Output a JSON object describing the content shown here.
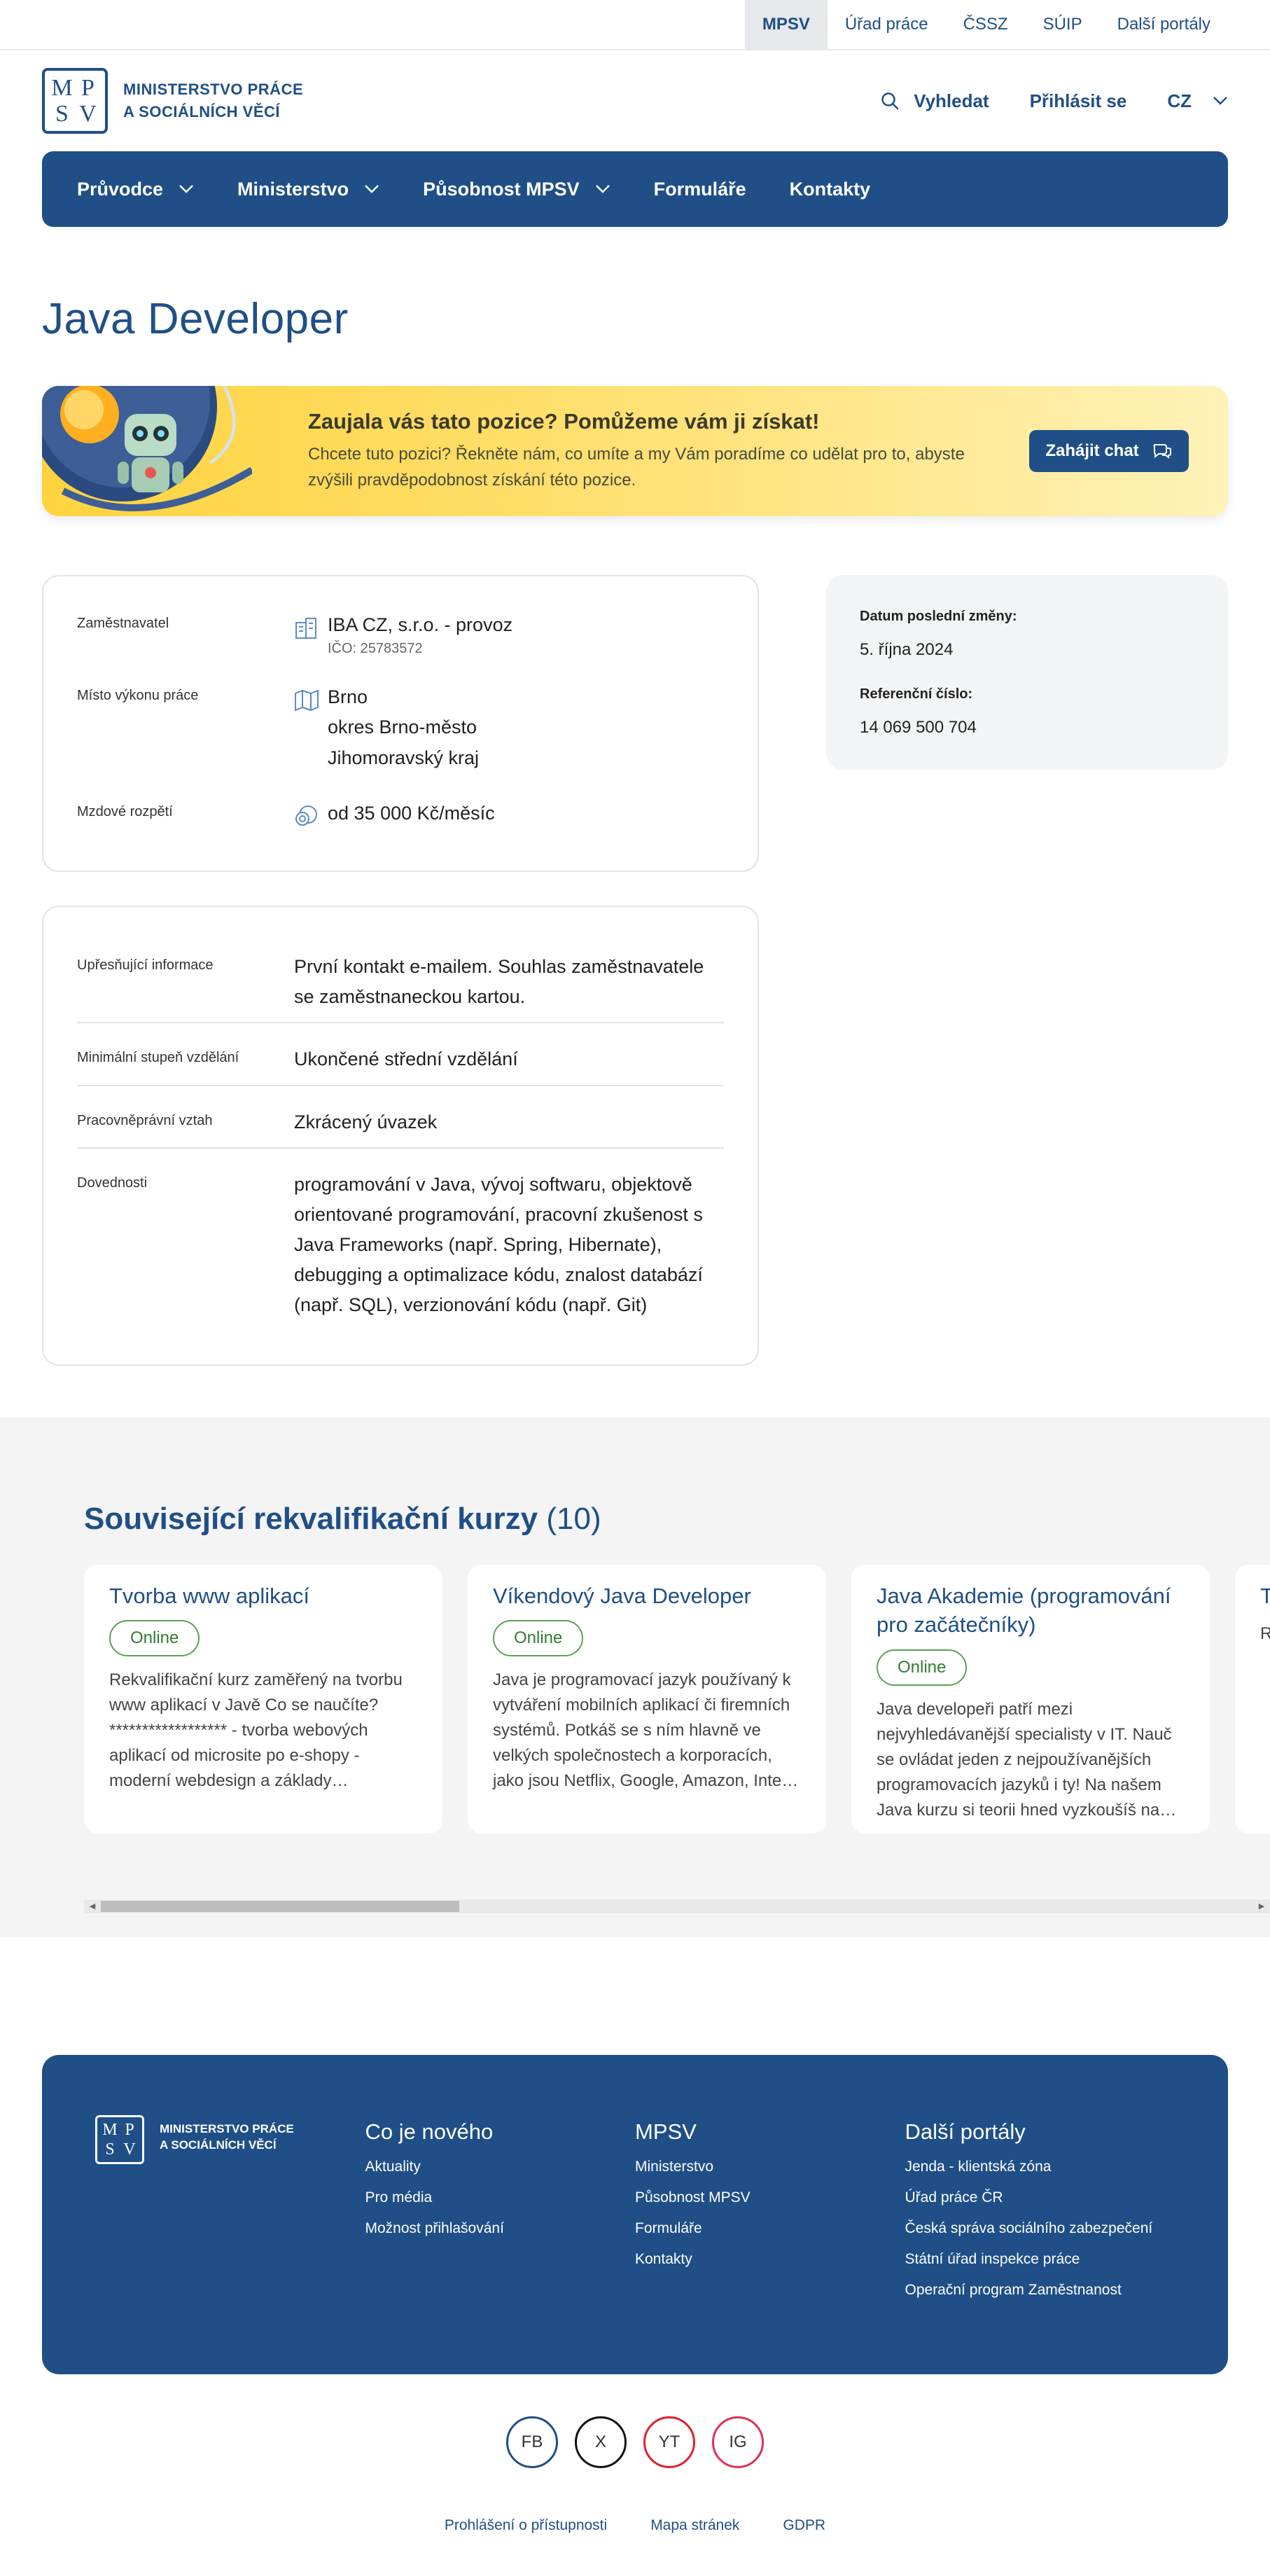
{
  "topbar": {
    "links": [
      "MPSV",
      "Úřad práce",
      "ČSSZ",
      "SÚIP",
      "Další portály"
    ],
    "active": "MPSV"
  },
  "logo": {
    "letters": [
      "M",
      "P",
      "S",
      "V"
    ],
    "line1": "MINISTERSTVO PRÁCE",
    "line2": "A SOCIÁLNÍCH VĚCÍ"
  },
  "header": {
    "search_label": "Vyhledat",
    "login_label": "Přihlásit se",
    "lang_label": "CZ"
  },
  "nav": {
    "items": [
      "Průvodce",
      "Ministerstvo",
      "Působnost MPSV",
      "Formuláře",
      "Kontakty"
    ]
  },
  "page_title": "Java Developer",
  "banner": {
    "title": "Zaujala vás tato pozice? Pomůžeme vám ji získat!",
    "subtitle": "Chcete tuto pozici? Řekněte nám, co umíte a my Vám poradíme co udělat pro to, abyste zvýšili pravděpodobnost získání této pozice.",
    "button": "Zahájit chat"
  },
  "job": {
    "employer_label": "Zaměstnavatel",
    "employer_name": "IBA CZ, s.r.o. - provoz",
    "employer_ico": "IČO: 25783572",
    "location_label": "Místo výkonu práce",
    "location_city": "Brno",
    "location_district": "okres Brno-město",
    "location_region": "Jihomoravský kraj",
    "salary_label": "Mzdové rozpětí",
    "salary_value": "od 35 000 Kč/měsíc"
  },
  "details": [
    {
      "label": "Upřesňující informace",
      "value": "První kontakt e-mailem. Souhlas zaměstnavatele se zaměstnaneckou kartou."
    },
    {
      "label": "Minimální stupeň vzdělání",
      "value": "Ukončené střední vzdělání"
    },
    {
      "label": "Pracovněprávní vztah",
      "value": "Zkrácený úvazek"
    },
    {
      "label": "Dovednosti",
      "value": "programování v Java, vývoj softwaru, objektově orientované programování, pracovní zkušenost s Java Frameworks (např. Spring, Hibernate), debugging a optimalizace kódu, znalost databází (např. SQL), verzionování kódu (např. Git)"
    }
  ],
  "meta": {
    "changed_label": "Datum poslední změny:",
    "changed_value": "5. října 2024",
    "ref_label": "Referenční číslo:",
    "ref_value": "14 069 500 704"
  },
  "courses": {
    "title": "Související rekvalifikační kurzy",
    "count": "(10)",
    "items": [
      {
        "title": "Tvorba www aplikací",
        "badge": "Online",
        "desc": "Rekvalifikační kurz zaměřený na tvorbu www aplikací v Javě Co se naučíte? ****************** - tvorba webových aplikací od microsite po e-shopy - moderní webdesign a základy…"
      },
      {
        "title": "Víkendový Java Developer",
        "badge": "Online",
        "desc": "Java je programovací jazyk používaný k vytváření mobilních aplikací či firemních systémů. Potkáš se s ním hlavně ve velkých společnostech a korporacích, jako jsou Netflix, Google, Amazon, Inte…"
      },
      {
        "title": "Java Akademie (programování pro začátečníky)",
        "badge": "Online",
        "desc": "Java developeři patří mezi nejvyhledávanější specialisty v IT. Nauč se ovládat jeden z nejpoužívanějších programovacích jazyků i ty! Na našem Java kurzu si teorii hned vyzkoušíš na…"
      },
      {
        "title": "T",
        "badge": "",
        "desc": "R w m a"
      }
    ]
  },
  "footer": {
    "logo_line1": "MINISTERSTVO PRÁCE",
    "logo_line2": "A SOCIÁLNÍCH VĚCÍ",
    "columns": [
      {
        "title": "Co je nového",
        "links": [
          "Aktuality",
          "Pro média",
          "Možnost přihlašování"
        ]
      },
      {
        "title": "MPSV",
        "links": [
          "Ministerstvo",
          "Působnost MPSV",
          "Formuláře",
          "Kontakty"
        ]
      },
      {
        "title": "Další portály",
        "links": [
          "Jenda - klientská zóna",
          "Úřad práce ČR",
          "Česká správa sociálního zabezpečení",
          "Státní úřad inspekce práce",
          "Operační program Zaměstnanost"
        ]
      }
    ]
  },
  "social": [
    {
      "label": "FB",
      "color": "#1f4f86"
    },
    {
      "label": "X",
      "color": "#111111"
    },
    {
      "label": "YT",
      "color": "#e0202a"
    },
    {
      "label": "IG",
      "color": "#e0305a"
    }
  ],
  "bottom_links": [
    "Prohlášení o přístupnosti",
    "Mapa stránek",
    "GDPR"
  ]
}
